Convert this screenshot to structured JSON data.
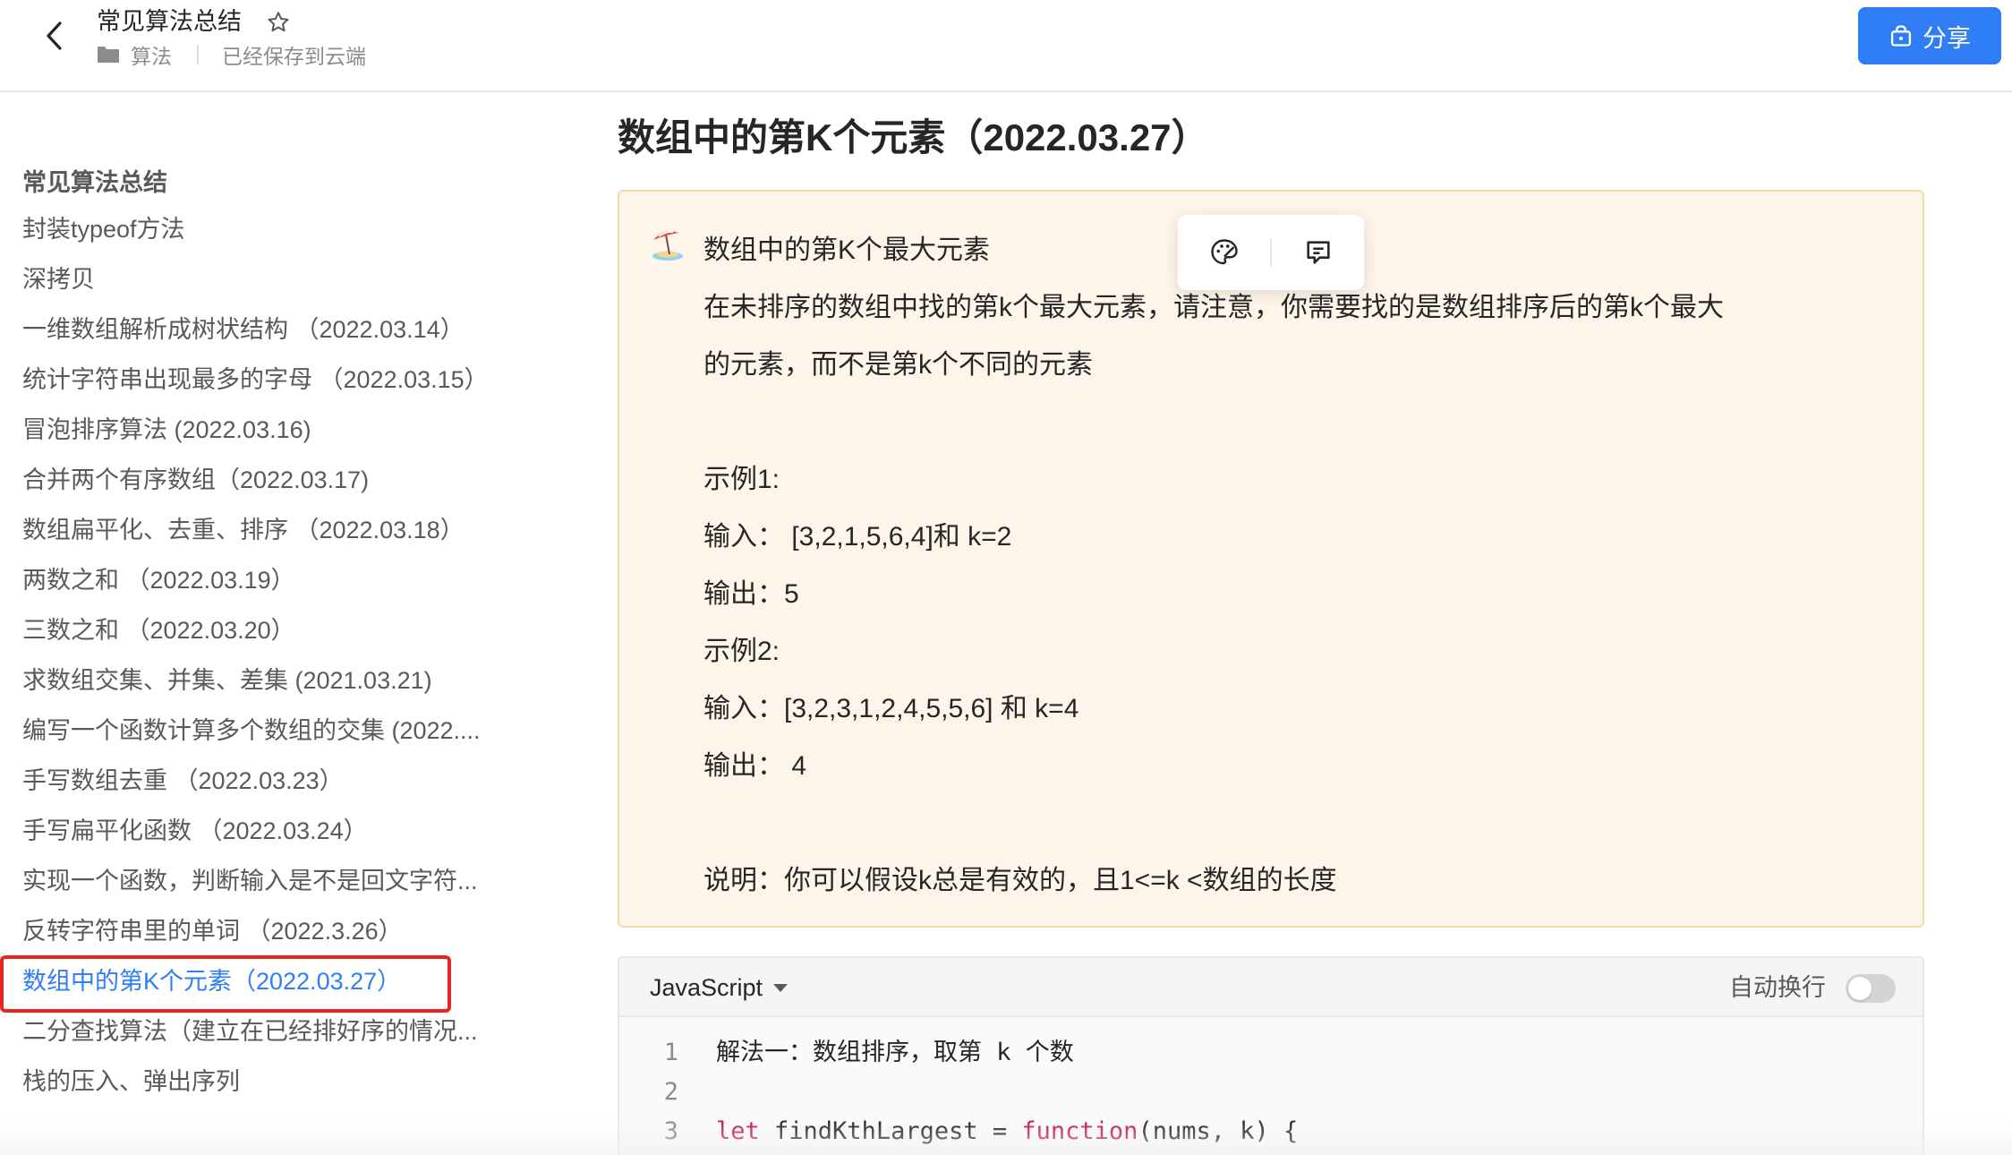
{
  "header": {
    "title": "常见算法总结",
    "folder": "算法",
    "save_status": "已经保存到云端",
    "share_label": "分享"
  },
  "toc": {
    "heading": "常见算法总结",
    "items": [
      "封装typeof方法",
      "深拷贝",
      "一维数组解析成树状结构 （2022.03.14）",
      "统计字符串出现最多的字母 （2022.03.15）",
      "冒泡排序算法 (2022.03.16)",
      "合并两个有序数组（2022.03.17)",
      "数组扁平化、去重、排序 （2022.03.18）",
      "两数之和 （2022.03.19）",
      "三数之和 （2022.03.20）",
      "求数组交集、并集、差集 (2021.03.21)",
      "编写一个函数计算多个数组的交集 (2022....",
      "手写数组去重 （2022.03.23）",
      "手写扁平化函数 （2022.03.24）",
      "实现一个函数，判断输入是不是回文字符...",
      "反转字符串里的单词 （2022.3.26）",
      "数组中的第K个元素（2022.03.27）",
      "二分查找算法（建立在已经排好序的情况...",
      "栈的压入、弹出序列"
    ],
    "active_index": 15
  },
  "main": {
    "title": "数组中的第K个元素（2022.03.27）",
    "callout": {
      "emoji": "beach-umbrella-icon",
      "lines": [
        "数组中的第K个最大元素",
        "在未排序的数组中找的第k个最大元素，请注意，你需要找的是数组排序后的第k个最大",
        "的元素，而不是第k个不同的元素",
        "",
        "示例1:",
        "输入： [3,2,1,5,6,4]和 k=2",
        "输出：5",
        "示例2:",
        "输入：[3,2,3,1,2,4,5,5,6] 和 k=4",
        "输出： 4",
        "",
        "说明：你可以假设k总是有效的，且1<=k <数组的长度"
      ]
    },
    "code": {
      "language": "JavaScript",
      "wrap_label": "自动换行",
      "wrap_enabled": false,
      "lines": [
        {
          "num": "1",
          "text": "解法一：数组排序，取第 k 个数"
        },
        {
          "num": "2",
          "text": ""
        },
        {
          "num": "3",
          "text": "let findKthLargest = function(nums, k) {"
        }
      ]
    }
  },
  "colors": {
    "accent": "#2f7ef5",
    "callout_bg": "#fef5ea",
    "highlight_box": "#e8251e"
  }
}
